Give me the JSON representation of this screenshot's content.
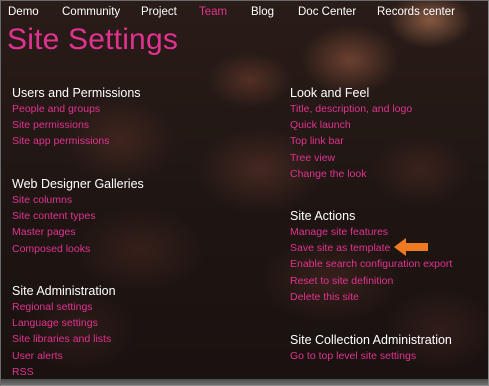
{
  "nav": {
    "items": [
      {
        "label": "Demo"
      },
      {
        "label": "Community"
      },
      {
        "label": "Project"
      },
      {
        "label": "Team"
      },
      {
        "label": "Blog"
      },
      {
        "label": "Doc Center"
      },
      {
        "label": "Records center"
      }
    ],
    "active": "Team"
  },
  "page_title": "Site Settings",
  "colors": {
    "accent": "#e0338f",
    "heading": "#ffffff",
    "arrow": "#f07a22"
  },
  "sections": {
    "users_permissions": {
      "title": "Users and Permissions",
      "links": [
        "People and groups",
        "Site permissions",
        "Site app permissions"
      ]
    },
    "web_designer_galleries": {
      "title": "Web Designer Galleries",
      "links": [
        "Site columns",
        "Site content types",
        "Master pages",
        "Composed looks"
      ]
    },
    "site_administration": {
      "title": "Site Administration",
      "links": [
        "Regional settings",
        "Language settings",
        "Site libraries and lists",
        "User alerts",
        "RSS"
      ]
    },
    "look_and_feel": {
      "title": "Look and Feel",
      "links": [
        "Title, description, and logo",
        "Quick launch",
        "Top link bar",
        "Tree view",
        "Change the look"
      ]
    },
    "site_actions": {
      "title": "Site Actions",
      "links": [
        "Manage site features",
        "Save site as template",
        "Enable search configuration export",
        "Reset to site definition",
        "Delete this site"
      ]
    },
    "site_collection_administration": {
      "title": "Site Collection Administration",
      "links": [
        "Go to top level site settings"
      ]
    }
  },
  "annotation": {
    "icon": "arrow-left-icon",
    "points_to": "Save site as template"
  }
}
